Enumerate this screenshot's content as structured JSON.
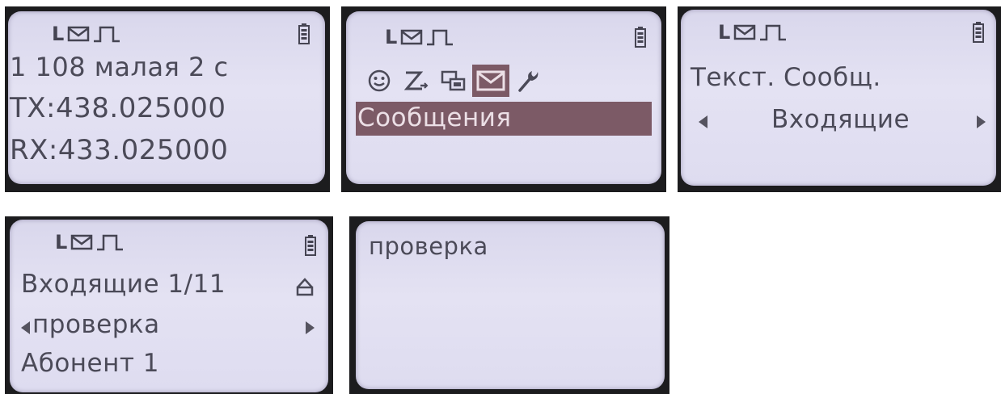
{
  "colors": {
    "lcd_background": "#e2e0f2",
    "lcd_text": "#4b4a58",
    "selection": "#7c5a66",
    "frame": "#1c1c1e"
  },
  "status_icons": [
    "signal-l-icon",
    "envelope-icon",
    "pulse-icon",
    "battery-icon"
  ],
  "screens": [
    {
      "name": "home",
      "channel_line": "1 108 малая 2 с",
      "tx_line": "TX:438.025000",
      "rx_line": "RX:433.025000"
    },
    {
      "name": "main-menu",
      "menu_icons": [
        "contacts-face-icon",
        "scan-icon",
        "channels-icon",
        "messages-envelope-icon",
        "settings-wrench-icon"
      ],
      "selected_icon": "messages-envelope-icon",
      "selected_label": "Сообщения"
    },
    {
      "name": "messages-menu",
      "title": "Текст. Сообщ.",
      "option": "Входящие"
    },
    {
      "name": "inbox",
      "header": "Входящие 1/11",
      "message_preview": "проверка",
      "sender": "Абонент 1"
    },
    {
      "name": "message-view",
      "message_text": "проверка"
    }
  ]
}
